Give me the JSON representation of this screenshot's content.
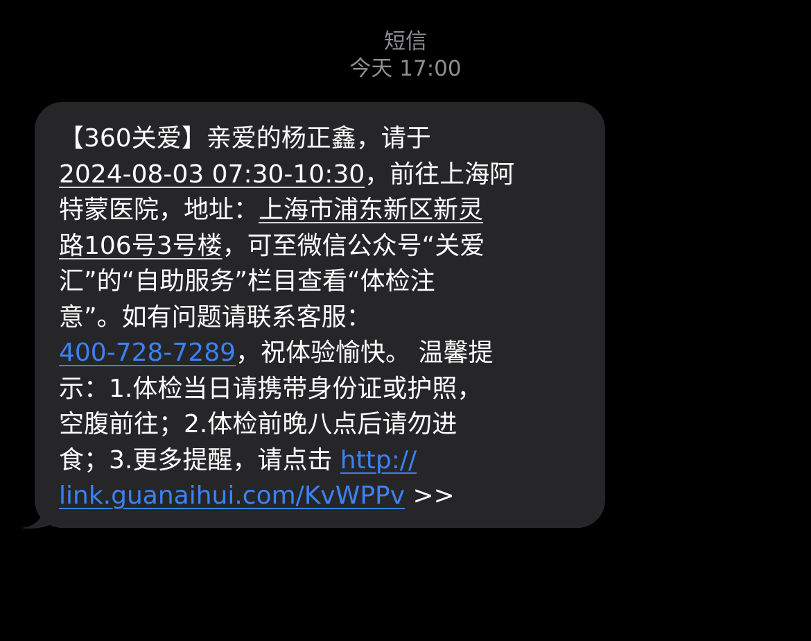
{
  "header": {
    "sender": "短信",
    "timestamp": "今天 17:00"
  },
  "message": {
    "l1": "【360关爱】亲爱的杨正鑫，请于",
    "l2_date": "2024-08-03 07:30-10:30",
    "l2_rest": "，前往上海阿",
    "l3_pre": "特蒙医院，地址：",
    "l3_addr": "上海市浦东新区新灵",
    "l4_addr": "路106号3号楼",
    "l4_rest": "，可至微信公众号“关爱",
    "l5": "汇”的“自助服务”栏目查看“体检注",
    "l6": "意”。如有问题请联系客服：",
    "l7_phone": "400-728-7289",
    "l7_rest": "，祝体验愉快。 温馨提",
    "l8": "示：1.体检当日请携带身份证或护照，",
    "l9": "空腹前往；2.体检前晚八点后请勿进",
    "l10_pre": "食；3.更多提醒，请点击 ",
    "l10_link": "http://",
    "l11_link": "link.guanaihui.com/KvWPPv",
    "l11_rest": " >>"
  },
  "colors": {
    "background": "#000000",
    "bubble": "#262629",
    "link": "#3b82f6",
    "meta_text": "#8e8e93"
  }
}
